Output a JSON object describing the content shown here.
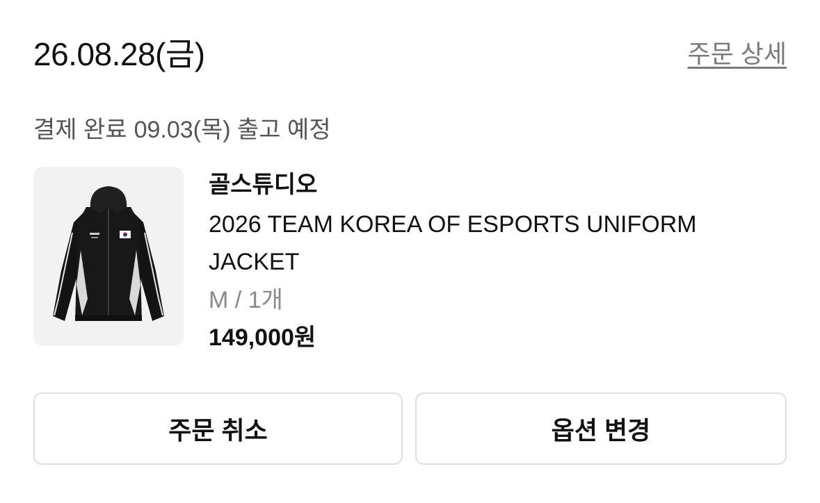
{
  "order": {
    "date": "26.08.28(금)",
    "detail_link": "주문 상세",
    "status": "결제 완료",
    "shipping_eta": "09.03(목) 출고 예정"
  },
  "item": {
    "brand": "골스튜디오",
    "name": "2026 TEAM KOREA OF ESPORTS UNIFORM JACKET",
    "option": "M / 1개",
    "price": "149,000원",
    "image_icon": "black-track-jacket-image"
  },
  "actions": {
    "cancel_label": "주문 취소",
    "change_option_label": "옵션 변경"
  },
  "colors": {
    "text": "#111111",
    "muted": "#8a8a8a",
    "link": "#7a7a7a",
    "border": "#dedede",
    "thumb_bg": "#f2f2f2"
  }
}
